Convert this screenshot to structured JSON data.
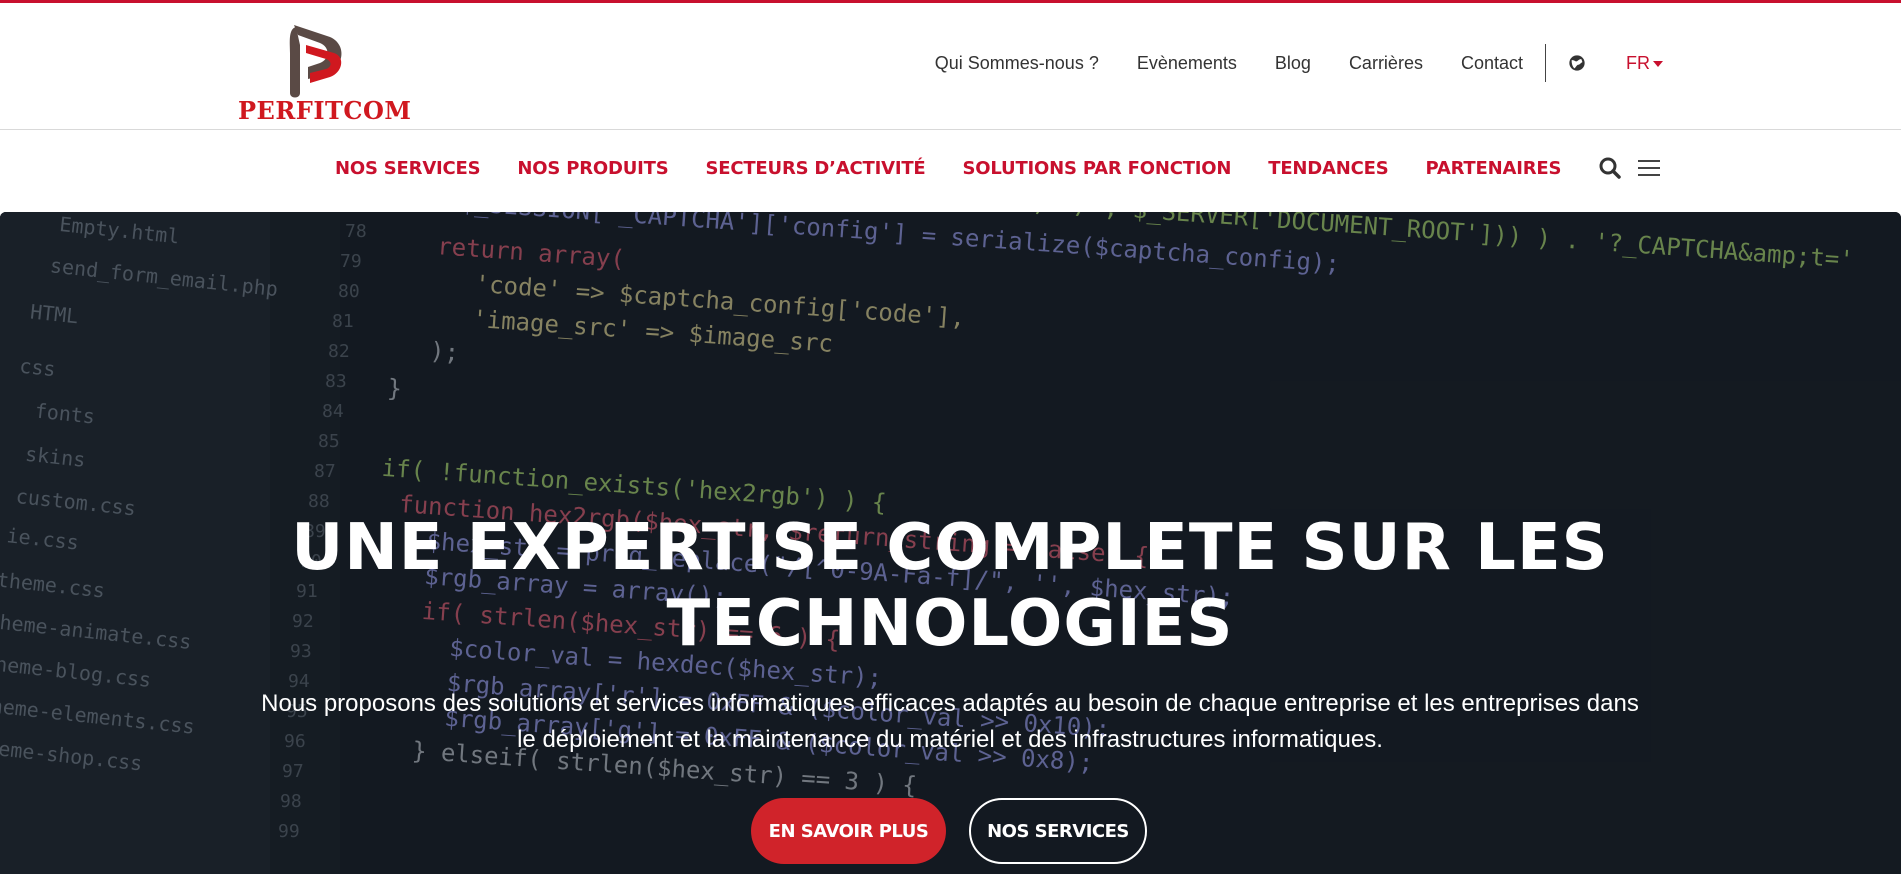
{
  "brand": {
    "name": "PERFITCOM",
    "accent_color": "#c8102e",
    "logo_dark_color": "#5a4a45"
  },
  "top_nav": {
    "items": [
      {
        "label": "Qui Sommes-nous ?"
      },
      {
        "label": "Evènements"
      },
      {
        "label": "Blog"
      },
      {
        "label": "Carrières"
      },
      {
        "label": "Contact"
      }
    ],
    "globe_icon": "globe-icon",
    "language": "FR"
  },
  "main_nav": {
    "items": [
      {
        "label": "NOS SERVICES"
      },
      {
        "label": "NOS PRODUITS"
      },
      {
        "label": "SECTEURS D’ACTIVITÉ"
      },
      {
        "label": "SOLUTIONS PAR FONCTION"
      },
      {
        "label": "TENDANCES"
      },
      {
        "label": "PARTENAIRES"
      }
    ],
    "icons": [
      "search-icon",
      "menu-icon"
    ]
  },
  "hero": {
    "title": "UNE EXPERTISE COMPLETE SUR LES TECHNOLOGIES",
    "subtitle": "Nous proposons des solutions et services informatiques efficaces adaptés au besoin de chaque entreprise et les entreprises dans le déploiement et la maintenance du matériel et des infrastructures informatiques.",
    "primary_button": "EN SAVOIR PLUS",
    "secondary_button": "NOS SERVICES",
    "primary_color": "#d0232a"
  }
}
